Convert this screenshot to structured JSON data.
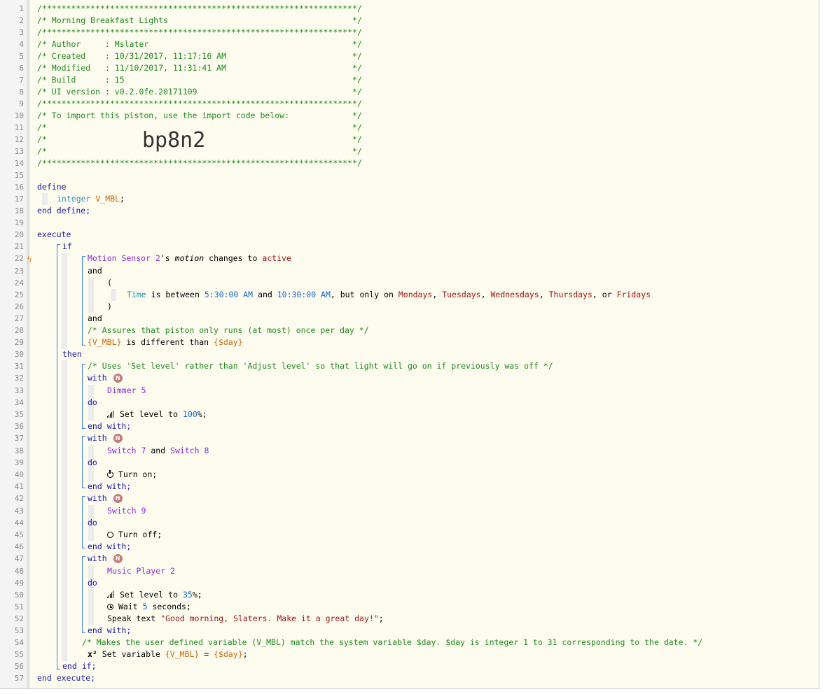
{
  "lines": [
    "/*****************************************************************/",
    "/* Morning Breakfast Lights                                      */",
    "/*****************************************************************/",
    "/* Author     : Mslater                                          */",
    "/* Created    : 10/31/2017, 11:17:16 AM                          */",
    "/* Modified   : 11/10/2017, 11:31:41 AM                          */",
    "/* Build      : 15                                               */",
    "/* UI version : v0.2.0fe.20171109                                */",
    "/*****************************************************************/",
    "/* To import this piston, use the import code below:             */",
    "/*                                                               */",
    "/*                                                               */",
    "/*                                                               */",
    "/*****************************************************************/"
  ],
  "import_code": "bp8n2",
  "define": {
    "kw_define": "define",
    "type": "integer",
    "var": "V_MBL",
    "semi": ";",
    "kw_end_define": "end define;"
  },
  "execute": {
    "kw_execute": "execute",
    "kw_if": "if",
    "kw_and1": "and",
    "open_paren": "(",
    "close_paren": ")",
    "kw_and2": "and",
    "kw_then": "then",
    "kw_end_if": "end if;",
    "kw_end_execute": "end execute;",
    "cond1": {
      "device": "Motion Sensor 2",
      "poss": "'s",
      "attr": "motion",
      "op": "changes to",
      "value": "active"
    },
    "cond2": {
      "subject": "Time",
      "op": "is between",
      "t1": "5:30:00 AM",
      "and": "and",
      "t2": "10:30:00 AM",
      "tail": ", but only on",
      "d1": "Mondays",
      "d2": "Tuesdays",
      "d3": "Wednesdays",
      "d4": "Thursdays",
      "or": "or",
      "d5": "Fridays",
      "sep": ","
    },
    "comment_once": "/* Assures that piston only runs (at most) once per day */",
    "cond3": {
      "left": "{V_MBL}",
      "op": "is different than",
      "right": "{$day}"
    },
    "comment_setlevel": "/* Uses 'Set level' rather than 'Adjust level' so that light will go on if previously was off */",
    "kw_with": "with",
    "kw_do": "do",
    "kw_end_with": "end with;",
    "badge": "N",
    "with1": {
      "device": "Dimmer 5",
      "action": "Set level to",
      "value": "100",
      "unit": "%;"
    },
    "with2": {
      "device1": "Switch 7",
      "and": "and",
      "device2": "Switch 8",
      "action": "Turn on;"
    },
    "with3": {
      "device": "Switch 9",
      "action": "Turn off;"
    },
    "with4": {
      "device": "Music Player 2",
      "action1": "Set level to",
      "value1": "35",
      "unit1": "%;",
      "action2": "Wait",
      "value2": "5",
      "unit2": "seconds;",
      "action3": "Speak text",
      "text": "\"Good morning, Slaters. Make it a great day!\"",
      "semi": ";"
    },
    "comment_var": "/* Makes the user defined variable (V_MBL) match the system variable $day. $day is integer 1 to 31 corresponding to the date. */",
    "setvar": {
      "icon": "x²",
      "action": "Set variable",
      "left": "{V_MBL}",
      "eq": "=",
      "right": "{$day}",
      "semi": ";"
    }
  },
  "colors": {
    "comment": "#1d8b1d",
    "keyword": "#1818b0",
    "device": "#8a2be2",
    "variable": "#c96a10",
    "number": "#1b65d2",
    "string": "#a31515",
    "background": "#fdfcef",
    "trigger": "#f08a24"
  }
}
